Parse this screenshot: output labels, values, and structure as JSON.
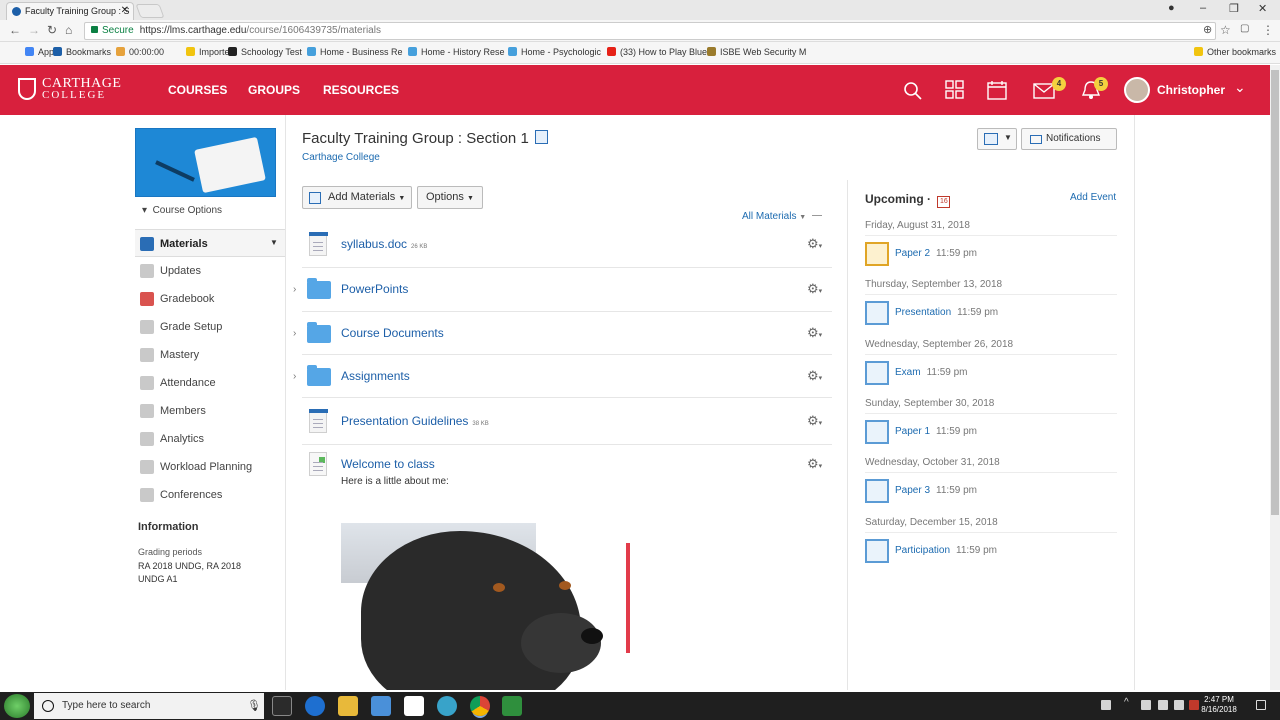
{
  "browser": {
    "tab_title": "Faculty Training Group : S",
    "secure_label": "Secure",
    "url_host": "https://lms.carthage.edu",
    "url_path": "/course/1606439735/materials",
    "bookmarks": [
      {
        "label": "Apps",
        "color": "#4285f4"
      },
      {
        "label": "Bookmarks",
        "color": "#1d5fa8"
      },
      {
        "label": "00:00:00",
        "color": "#e6a23c"
      },
      {
        "label": "Imported",
        "color": "#f1c40f"
      },
      {
        "label": "Schoology Test",
        "color": "#222222"
      },
      {
        "label": "Home - Business Re",
        "color": "#46a0dc"
      },
      {
        "label": "Home - History Rese",
        "color": "#46a0dc"
      },
      {
        "label": "Home - Psychologic",
        "color": "#46a0dc"
      },
      {
        "label": "(33) How to Play Blue",
        "color": "#e62117"
      },
      {
        "label": "ISBE Web Security M",
        "color": "#9a7b2c"
      }
    ],
    "other_bookmarks": "Other bookmarks"
  },
  "header": {
    "logo_line1": "CARTHAGE",
    "logo_line2": "COLLEGE",
    "nav": [
      "COURSES",
      "GROUPS",
      "RESOURCES"
    ],
    "mail_badge": "4",
    "notif_badge": "5",
    "user_name": "Christopher",
    "brand_color": "#d8203d"
  },
  "sidebar": {
    "course_options": "Course Options",
    "items": [
      {
        "label": "Materials",
        "icon": "materials-icon",
        "color": "#2a6db5"
      },
      {
        "label": "Updates",
        "icon": "updates-icon",
        "color": "#c9c9c9"
      },
      {
        "label": "Gradebook",
        "icon": "gradebook-icon",
        "color": "#d9534f"
      },
      {
        "label": "Grade Setup",
        "icon": "grade-setup-icon",
        "color": "#c9c9c9"
      },
      {
        "label": "Mastery",
        "icon": "mastery-icon",
        "color": "#c9c9c9"
      },
      {
        "label": "Attendance",
        "icon": "attendance-icon",
        "color": "#c9c9c9"
      },
      {
        "label": "Members",
        "icon": "members-icon",
        "color": "#c9c9c9"
      },
      {
        "label": "Analytics",
        "icon": "analytics-icon",
        "color": "#c9c9c9"
      },
      {
        "label": "Workload Planning",
        "icon": "workload-icon",
        "color": "#c9c9c9"
      },
      {
        "label": "Conferences",
        "icon": "conferences-icon",
        "color": "#c9c9c9"
      }
    ],
    "info_heading": "Information",
    "grading_label": "Grading periods",
    "grading_value": "RA 2018 UNDG, RA 2018 UNDG A1"
  },
  "main": {
    "title": "Faculty Training Group : Section 1",
    "subtitle": "Carthage College",
    "notifications_btn": "Notifications",
    "add_materials": "Add Materials",
    "options": "Options",
    "all_materials": "All Materials",
    "materials": [
      {
        "type": "file",
        "name": "syllabus.doc",
        "size": "26 KB"
      },
      {
        "type": "folder",
        "name": "PowerPoints",
        "size": ""
      },
      {
        "type": "folder",
        "name": "Course Documents",
        "size": ""
      },
      {
        "type": "folder",
        "name": "Assignments",
        "size": ""
      },
      {
        "type": "file",
        "name": "Presentation Guidelines",
        "size": "38 KB"
      },
      {
        "type": "page",
        "name": "Welcome to class",
        "size": ""
      }
    ],
    "welcome_text": "Here is a little about me:"
  },
  "upcoming": {
    "title": "Upcoming ·",
    "calendar_icon_text": "16",
    "add_event": "Add Event",
    "groups": [
      {
        "date": "Friday, August 31, 2018",
        "item": "Paper 2",
        "time": "11:59 pm",
        "icon": "assignment-icon"
      },
      {
        "date": "Thursday, September 13, 2018",
        "item": "Presentation",
        "time": "11:59 pm",
        "icon": "assignment-icon"
      },
      {
        "date": "Wednesday, September 26, 2018",
        "item": "Exam",
        "time": "11:59 pm",
        "icon": "assignment-icon"
      },
      {
        "date": "Sunday, September 30, 2018",
        "item": "Paper 1",
        "time": "11:59 pm",
        "icon": "assignment-icon"
      },
      {
        "date": "Wednesday, October 31, 2018",
        "item": "Paper 3",
        "time": "11:59 pm",
        "icon": "assignment-icon"
      },
      {
        "date": "Saturday, December 15, 2018",
        "item": "Participation",
        "time": "11:59 pm",
        "icon": "assignment-icon"
      }
    ]
  },
  "taskbar": {
    "search_placeholder": "Type here to search",
    "time": "2:47 PM",
    "date": "8/16/2018"
  }
}
